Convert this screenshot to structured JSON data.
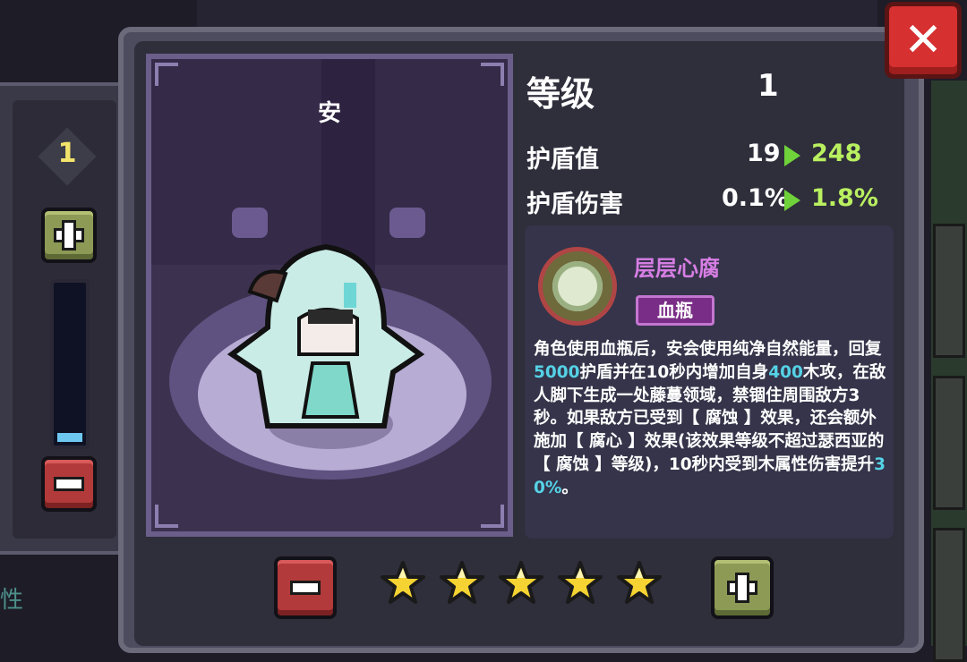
{
  "close_label": "✕",
  "left_panel": {
    "level_value": "1",
    "side_label": "性",
    "slider_fraction": 0.06
  },
  "portrait": {
    "name": "安"
  },
  "stats": {
    "level_label": "等级",
    "level_value": "1",
    "shield_label": "护盾值",
    "shield_old": "19",
    "shield_new": "248",
    "shield_damage_label": "护盾伤害",
    "shield_damage_old": "0.1%",
    "shield_damage_new": "1.8%"
  },
  "skill": {
    "name": "层层心腐",
    "tag": "血瓶",
    "desc_parts": [
      {
        "text": "角色使用血瓶后，安会使用纯净自然能量，回复",
        "hl": false
      },
      {
        "text": "5000",
        "hl": true
      },
      {
        "text": "护盾并在10秒内增加自身",
        "hl": false
      },
      {
        "text": "400",
        "hl": true
      },
      {
        "text": "木攻，在敌人脚下生成一处藤蔓领域，禁锢住周围敌方3秒。如果敌方已受到【 腐蚀 】效果，还会额外施加【 腐心 】效果(该效果等级不超过瑟西亚的【 腐蚀 】等级)，10秒内受到木属性伤害提升",
        "hl": false
      },
      {
        "text": "30%",
        "hl": true
      },
      {
        "text": "。",
        "hl": false
      }
    ]
  },
  "stars": {
    "count": 5,
    "filled": 5
  },
  "colors": {
    "accent_green": "#b9f060",
    "highlight_cyan": "#55d2e6",
    "skill_name_purple": "#d77ee4",
    "star_gold": "#f4d332"
  }
}
